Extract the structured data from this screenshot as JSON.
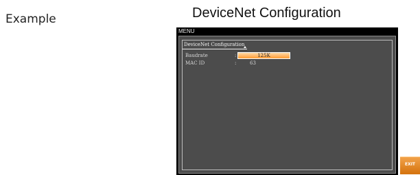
{
  "caption": {
    "example_label": "Example",
    "heading": "DeviceNet Configuration"
  },
  "screen": {
    "menu_title": "MENU",
    "section_title": "DeviceNet Configuration",
    "rows": [
      {
        "label": "Baudrate",
        "separator": ":",
        "value": "125K"
      },
      {
        "label": "MAC ID",
        "separator": ":",
        "value": "63"
      }
    ],
    "softkeys": {
      "exit_label": "EXIT"
    },
    "colors": {
      "highlight": "#ff9c33",
      "panel": "#4c4c4c",
      "exit": "#e0820f"
    }
  }
}
